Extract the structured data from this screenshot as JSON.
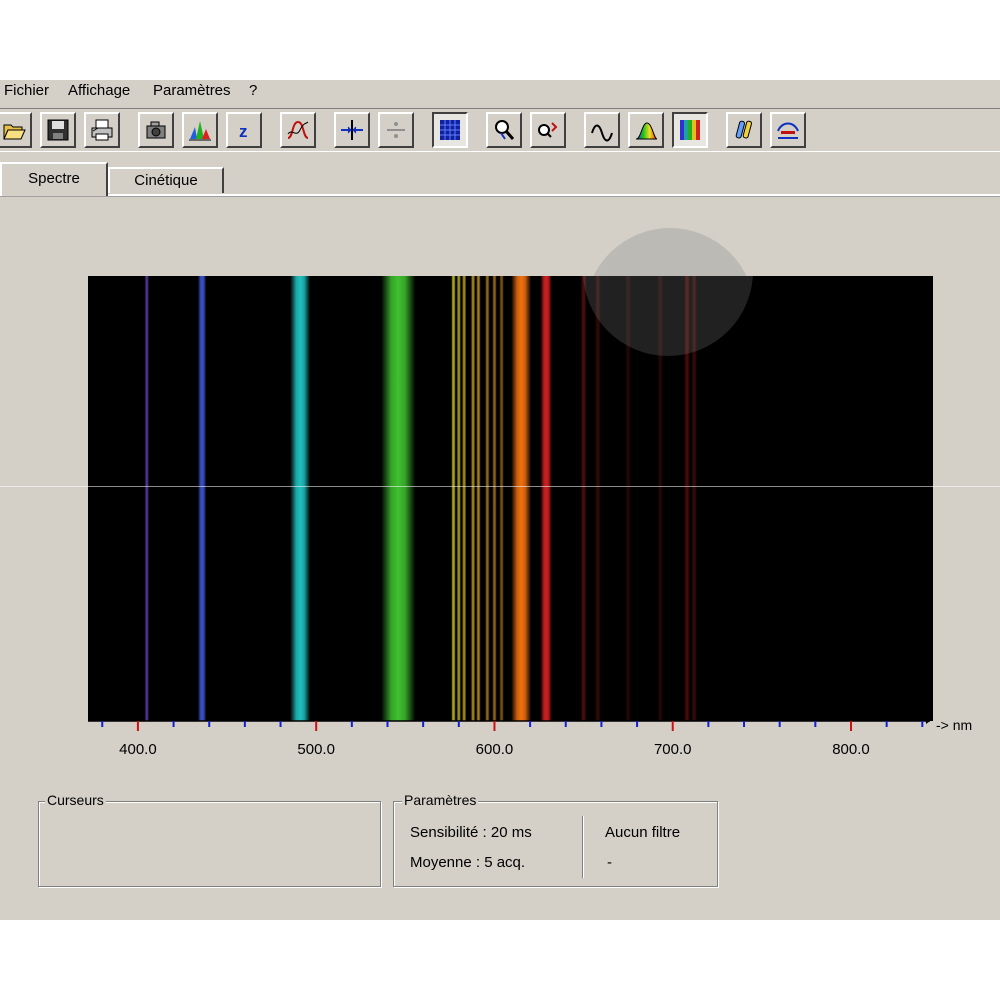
{
  "menu": {
    "items": [
      {
        "label": "Fichier"
      },
      {
        "label": "Affichage"
      },
      {
        "label": "Paramètres"
      },
      {
        "label": "?"
      }
    ]
  },
  "toolbar": {
    "buttons": [
      {
        "icon": "open-folder-icon"
      },
      {
        "icon": "save-icon"
      },
      {
        "icon": "print-icon"
      },
      {
        "icon": "camera-icon"
      },
      {
        "icon": "spectrum-peaks-icon"
      },
      {
        "icon": "zero-reference-icon"
      },
      {
        "icon": "curve-icon"
      },
      {
        "icon": "expand-axis-icon"
      },
      {
        "icon": "divide-axis-icon"
      },
      {
        "icon": "grid-icon",
        "pressed": true
      },
      {
        "icon": "zoom-icon"
      },
      {
        "icon": "zoom-reset-icon"
      },
      {
        "icon": "wave-icon"
      },
      {
        "icon": "colored-spectrum-icon"
      },
      {
        "icon": "color-bands-icon",
        "pressed": true
      },
      {
        "icon": "tubes-icon"
      },
      {
        "icon": "calibration-icon"
      }
    ]
  },
  "tabs": [
    {
      "label": "Spectre",
      "active": true
    },
    {
      "label": "Cinétique",
      "active": false
    }
  ],
  "spectrum": {
    "x_range_nm": [
      372,
      846
    ],
    "unit_label": "-> nm",
    "tick_labels": [
      "400.0",
      "500.0",
      "600.0",
      "700.0",
      "800.0"
    ],
    "tick_values": [
      400,
      500,
      600,
      700,
      800
    ],
    "minor_tick_step": 20,
    "lines": [
      {
        "nm": 405,
        "width_nm": 1.5,
        "color": "#5a3aa8",
        "opacity": 0.9
      },
      {
        "nm": 436,
        "width_nm": 3.0,
        "color": "#3a50c8",
        "opacity": 1.0
      },
      {
        "nm": 491,
        "width_nm": 7.0,
        "color": "#20c0c0",
        "opacity": 1.0
      },
      {
        "nm": 546,
        "width_nm": 12.0,
        "color": "#40c030",
        "opacity": 1.0
      },
      {
        "nm": 577,
        "width_nm": 1.5,
        "color": "#c8c020",
        "opacity": 0.9
      },
      {
        "nm": 580,
        "width_nm": 1.5,
        "color": "#c8c020",
        "opacity": 0.8
      },
      {
        "nm": 583,
        "width_nm": 1.5,
        "color": "#d0b020",
        "opacity": 0.8
      },
      {
        "nm": 588,
        "width_nm": 1.5,
        "color": "#d0a820",
        "opacity": 0.8
      },
      {
        "nm": 591,
        "width_nm": 1.5,
        "color": "#d0a020",
        "opacity": 0.8
      },
      {
        "nm": 596,
        "width_nm": 1.5,
        "color": "#d09820",
        "opacity": 0.7
      },
      {
        "nm": 600,
        "width_nm": 1.5,
        "color": "#d09020",
        "opacity": 0.7
      },
      {
        "nm": 604,
        "width_nm": 1.5,
        "color": "#d08820",
        "opacity": 0.6
      },
      {
        "nm": 615,
        "width_nm": 7.0,
        "color": "#f07010",
        "opacity": 1.0
      },
      {
        "nm": 629,
        "width_nm": 4.0,
        "color": "#d02020",
        "opacity": 1.0
      },
      {
        "nm": 650,
        "width_nm": 2.0,
        "color": "#601010",
        "opacity": 0.8
      },
      {
        "nm": 658,
        "width_nm": 2.0,
        "color": "#501010",
        "opacity": 0.6
      },
      {
        "nm": 675,
        "width_nm": 2.0,
        "color": "#401010",
        "opacity": 0.5
      },
      {
        "nm": 693,
        "width_nm": 2.0,
        "color": "#401010",
        "opacity": 0.5
      },
      {
        "nm": 708,
        "width_nm": 2.0,
        "color": "#6a1010",
        "opacity": 0.7
      },
      {
        "nm": 712,
        "width_nm": 2.0,
        "color": "#5a1010",
        "opacity": 0.6
      }
    ]
  },
  "cursors_box": {
    "title": "Curseurs"
  },
  "params_box": {
    "title": "Paramètres",
    "sensitivity": "Sensibilité : 20 ms",
    "average": "Moyenne : 5 acq.",
    "filter": "Aucun filtre",
    "filter_value": "-"
  }
}
